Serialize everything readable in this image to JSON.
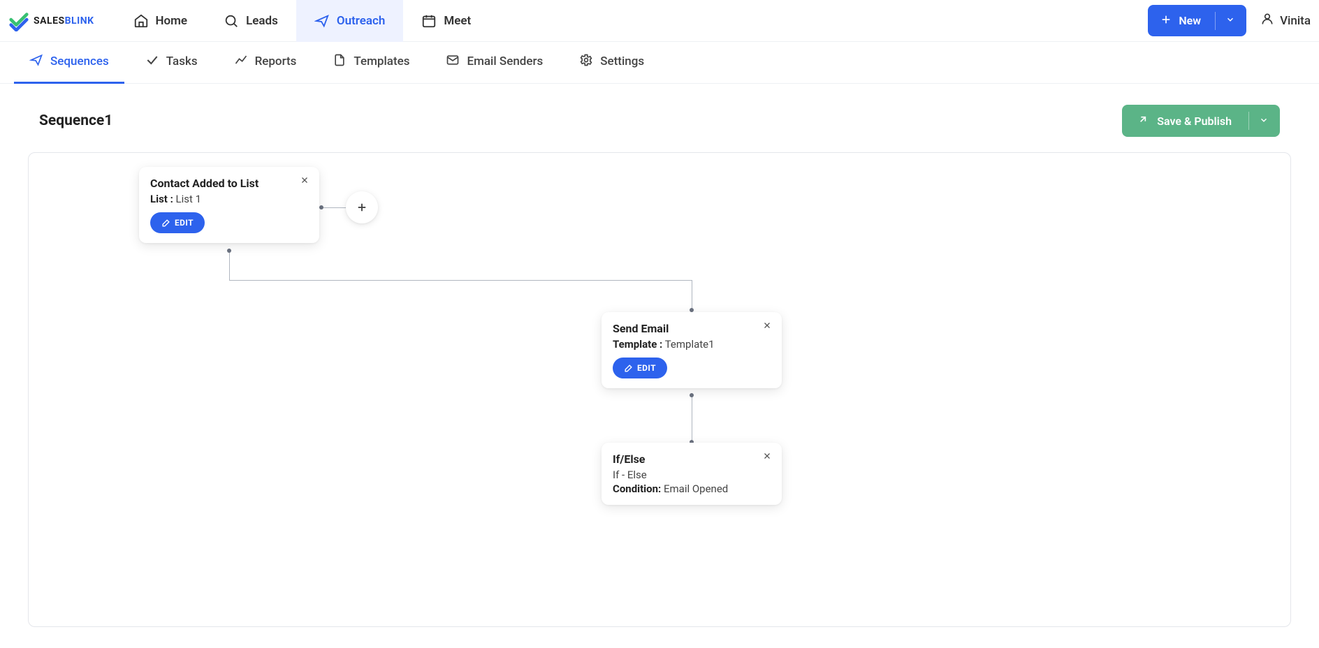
{
  "brand": {
    "name_a": "SALES",
    "name_b": "BLINK"
  },
  "top_nav": {
    "home": "Home",
    "leads": "Leads",
    "outreach": "Outreach",
    "meet": "Meet"
  },
  "actions": {
    "new": "New",
    "user": "Vinita"
  },
  "sub_nav": {
    "sequences": "Sequences",
    "tasks": "Tasks",
    "reports": "Reports",
    "templates": "Templates",
    "email_senders": "Email Senders",
    "settings": "Settings"
  },
  "page": {
    "title": "Sequence1",
    "save": "Save & Publish",
    "edit": "EDIT"
  },
  "nodes": {
    "n1": {
      "title": "Contact Added to List",
      "field_label": "List :",
      "field_value": " List 1"
    },
    "n2": {
      "title": "Send Email",
      "field_label": "Template :",
      "field_value": " Template1"
    },
    "n3": {
      "title": "If/Else",
      "subtitle": "If - Else",
      "field_label": "Condition:",
      "field_value": " Email Opened"
    }
  }
}
